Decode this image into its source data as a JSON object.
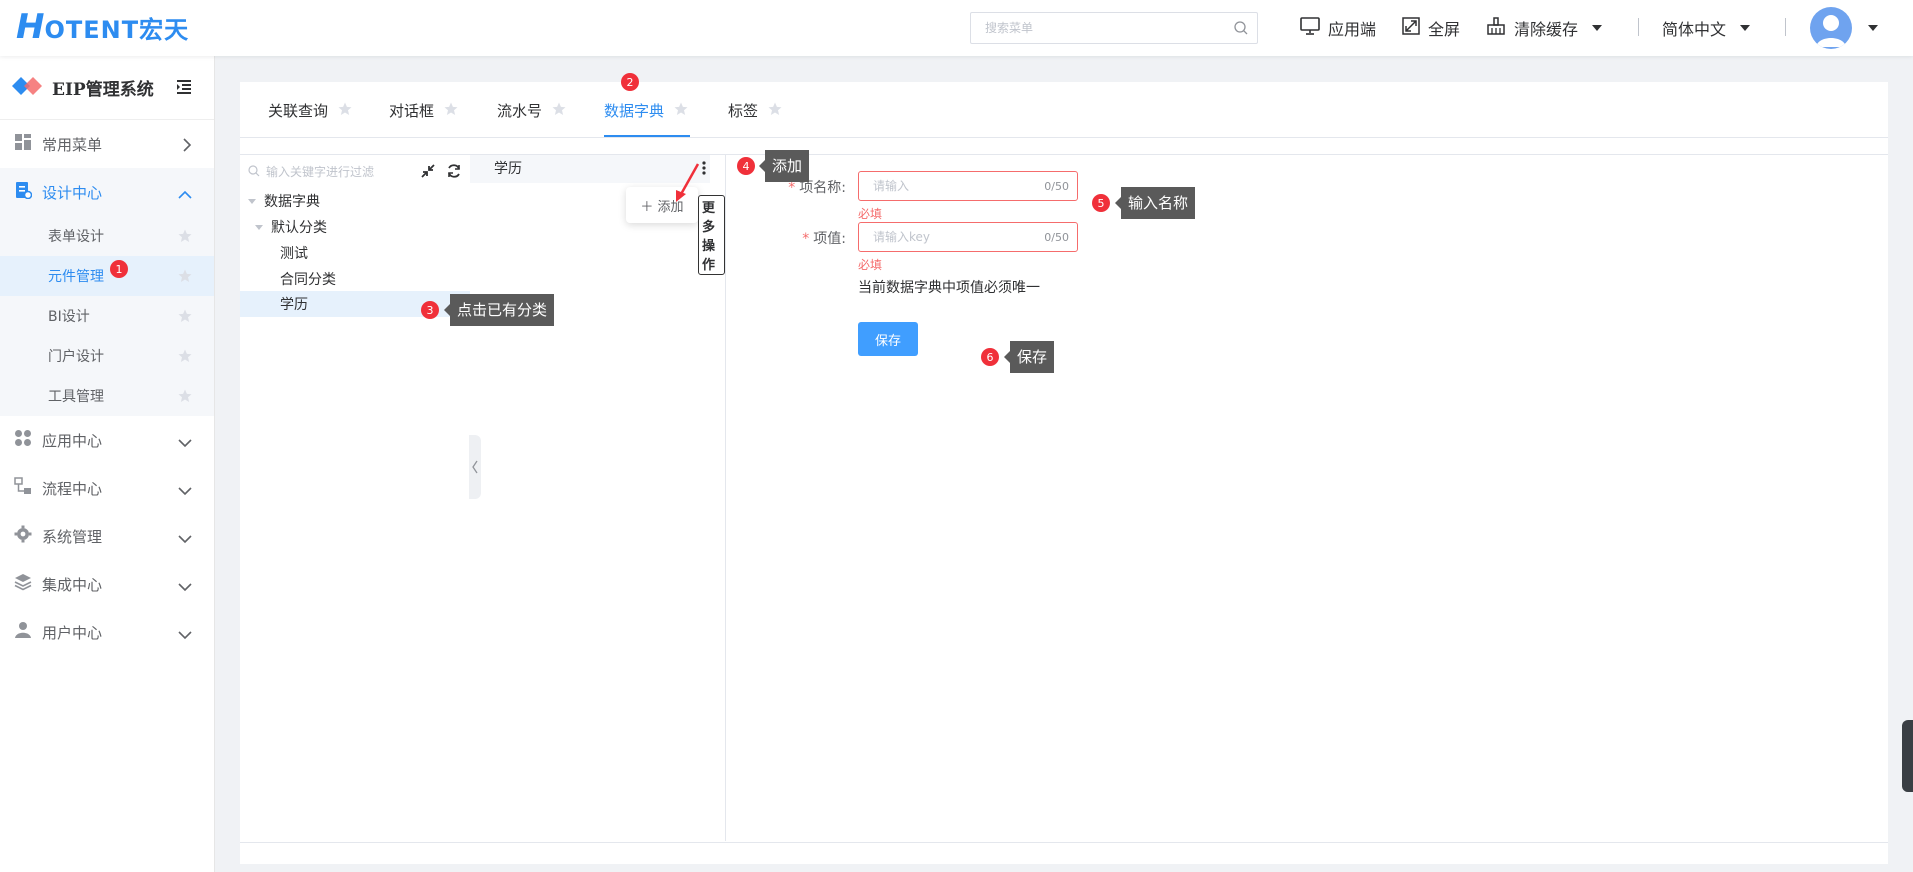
{
  "brand": {
    "logo_h": "H",
    "logo_rest": "OTENT宏天"
  },
  "header": {
    "search_placeholder": "搜索菜单",
    "app_end": "应用端",
    "fullscreen": "全屏",
    "clear_cache": "清除缓存",
    "language": "简体中文"
  },
  "sidebar": {
    "system_title": "EIP管理系统",
    "menus": [
      {
        "label": "常用菜单"
      },
      {
        "label": "设计中心"
      },
      {
        "label": "应用中心"
      },
      {
        "label": "流程中心"
      },
      {
        "label": "系统管理"
      },
      {
        "label": "集成中心"
      },
      {
        "label": "用户中心"
      }
    ],
    "design_subitems": [
      {
        "label": "表单设计"
      },
      {
        "label": "元件管理"
      },
      {
        "label": "BI设计"
      },
      {
        "label": "门户设计"
      },
      {
        "label": "工具管理"
      }
    ]
  },
  "tabs": [
    {
      "label": "关联查询"
    },
    {
      "label": "对话框"
    },
    {
      "label": "流水号"
    },
    {
      "label": "数据字典"
    },
    {
      "label": "标签"
    }
  ],
  "tree": {
    "search_placeholder": "输入关键字进行过滤",
    "root": "数据字典",
    "default_category": "默认分类",
    "children": [
      "测试",
      "合同分类",
      "学历"
    ]
  },
  "list": {
    "header": "学历",
    "dropdown_add": "＋ 添加",
    "more_ops": "更多操作"
  },
  "form": {
    "name_label": "项名称:",
    "name_placeholder": "请输入",
    "name_count": "0/50",
    "name_error": "必填",
    "value_label": "项值:",
    "value_placeholder": "请输入key",
    "value_count": "0/50",
    "value_error": "必填",
    "note": "当前数据字典中项值必须唯一",
    "save": "保存"
  },
  "annotations": {
    "badges": [
      "1",
      "2",
      "3",
      "4",
      "5",
      "6"
    ],
    "callouts": {
      "click_category": "点击已有分类",
      "add": "添加",
      "input_name": "输入名称",
      "save": "保存"
    }
  },
  "colors": {
    "accent": "#2d8cf0",
    "error": "#f56c6c",
    "badge": "#f0303a",
    "callout_bg": "#5a5a5a"
  }
}
